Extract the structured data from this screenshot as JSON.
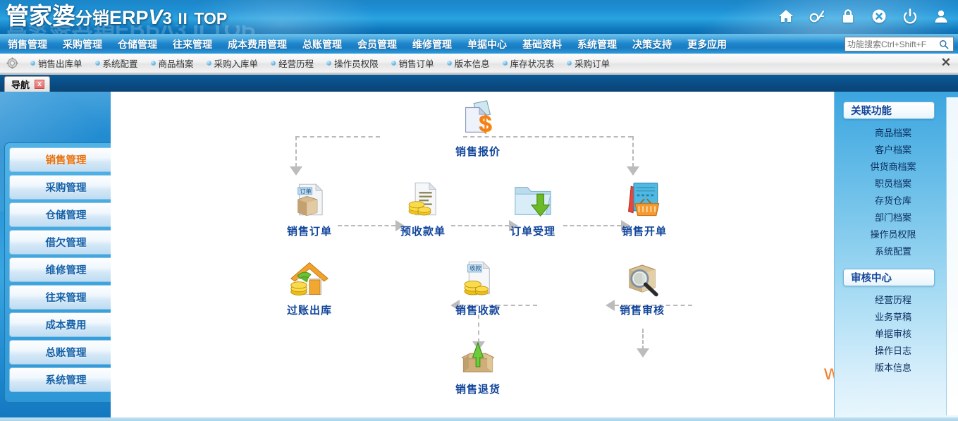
{
  "app": {
    "logo_cn": "管家婆",
    "logo_sub": "分销",
    "logo_erp": "ERP",
    "logo_v": "V",
    "logo_num": "3",
    "logo_ii": "II",
    "logo_top": "TOP",
    "accent_blue": "#1f8ad0",
    "accent_orange": "#e8710a",
    "label_color": "#13469b"
  },
  "titlebar_icons": [
    {
      "name": "home-icon",
      "title": "首页"
    },
    {
      "name": "font-size-icon",
      "title": "字体"
    },
    {
      "name": "lock-icon",
      "title": "锁定"
    },
    {
      "name": "close-circle-icon",
      "title": "关闭"
    },
    {
      "name": "power-icon",
      "title": "退出"
    },
    {
      "name": "user-icon",
      "title": "用户"
    }
  ],
  "menu": {
    "items": [
      "销售管理",
      "采购管理",
      "仓储管理",
      "往来管理",
      "成本费用管理",
      "总账管理",
      "会员管理",
      "维修管理",
      "单据中心",
      "基础资料",
      "系统管理",
      "决策支持",
      "更多应用"
    ],
    "search": {
      "placeholder": "功能搜索Ctrl+Shift+F",
      "value": "",
      "icon": "search-icon"
    }
  },
  "quickbar": {
    "gear_icon": "gear-icon",
    "links": [
      "销售出库单",
      "系统配置",
      "商品档案",
      "采购入库单",
      "经营历程",
      "操作员权限",
      "销售订单",
      "版本信息",
      "库存状况表",
      "采购订单"
    ],
    "close_label": "✕"
  },
  "tabs": {
    "active": "导航",
    "close_label": "x"
  },
  "sidebar": {
    "items": [
      {
        "label": "销售管理",
        "active": true
      },
      {
        "label": "采购管理",
        "active": false
      },
      {
        "label": "仓储管理",
        "active": false
      },
      {
        "label": "借欠管理",
        "active": false
      },
      {
        "label": "维修管理",
        "active": false
      },
      {
        "label": "往来管理",
        "active": false
      },
      {
        "label": "成本费用",
        "active": false
      },
      {
        "label": "总账管理",
        "active": false
      },
      {
        "label": "系统管理",
        "active": false
      }
    ]
  },
  "flow": {
    "nodes": [
      {
        "id": "quote",
        "label": "销售报价",
        "icon": "document-dollar-icon"
      },
      {
        "id": "order",
        "label": "销售订单",
        "icon": "order-box-document-icon"
      },
      {
        "id": "prepay",
        "label": "预收款单",
        "icon": "document-coins-icon"
      },
      {
        "id": "accept",
        "label": "订单受理",
        "icon": "folder-download-icon"
      },
      {
        "id": "invoice",
        "label": "销售开单",
        "icon": "basket-invoice-icon"
      },
      {
        "id": "posting",
        "label": "过账出库",
        "icon": "house-coins-icon"
      },
      {
        "id": "receipt",
        "label": "销售收款",
        "icon": "receipt-coins-icon"
      },
      {
        "id": "audit",
        "label": "销售审核",
        "icon": "magnifier-box-icon"
      },
      {
        "id": "return",
        "label": "销售退货",
        "icon": "box-uparrow-icon"
      }
    ]
  },
  "rightpanel": {
    "sections": [
      {
        "title": "关联功能",
        "items": [
          "商品档案",
          "客户档案",
          "供货商档案",
          "职员档案",
          "存货仓库",
          "部门档案",
          "操作员权限",
          "系统配置"
        ]
      },
      {
        "title": "审核中心",
        "items": [
          "经营历程",
          "业务草稿",
          "单据审核",
          "操作日志",
          "版本信息"
        ]
      }
    ]
  },
  "watermark": "www.baimao.com"
}
